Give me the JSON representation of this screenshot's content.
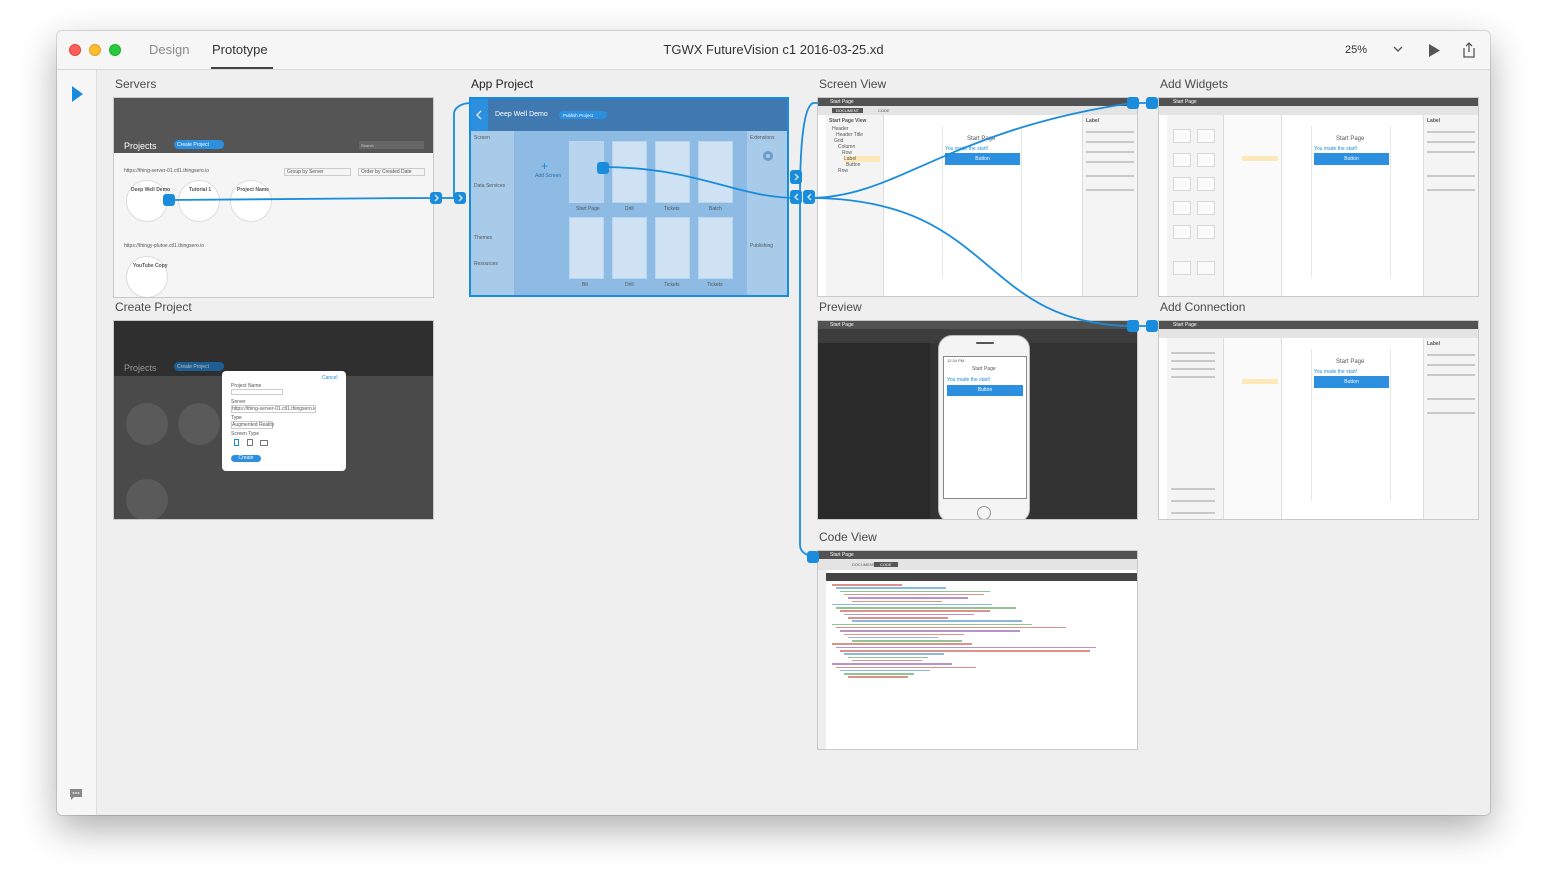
{
  "window": {
    "title": "TGWX FutureVision c1 2016-03-25.xd",
    "tabs": [
      "Design",
      "Prototype"
    ],
    "active_tab": "Prototype",
    "zoom": "25%"
  },
  "icons": {
    "play": "play-icon",
    "share": "share-icon",
    "select": "select-arrow-icon",
    "comment": "comment-icon"
  },
  "colors": {
    "accent": "#1a8cdc",
    "wire": "#1a8cdc"
  },
  "artboards": {
    "servers": {
      "label": "Servers",
      "heading": "Projects",
      "create_btn": "Create Project",
      "search": "Search",
      "group_by": "Group by Server",
      "order_by": "Order by Created Date",
      "server1": "https://thing-server-01.ctl1.thingsero.io",
      "server2": "https://thingy-plutoe.ctl1.thingsero.io",
      "projects": [
        "Deep Well Demo",
        "Tutorial 1",
        "Project Name",
        "YouTube Copy"
      ]
    },
    "create_project": {
      "label": "Create Project",
      "heading": "Projects",
      "create_btn": "Create Project",
      "cancel": "Cancel",
      "field_name": "Project Name",
      "field_server": "Server",
      "server_value": "https://thing-server-01.ctl1.thingsero.io",
      "field_type": "Type",
      "type_value": "Augmented Reality",
      "field_screen": "Screen Type",
      "create": "Create"
    },
    "app_project": {
      "label": "App Project",
      "title": "Deep Well Demo",
      "publish": "Publish Project",
      "screens": [
        "Start Page",
        "Drill",
        "Tickets",
        "Batch",
        "Bit",
        "Drill",
        "Tickets",
        "Tickets"
      ],
      "sections": [
        "Screen",
        "Data Services",
        "Themes",
        "Resources",
        "Extensions",
        "Publishing"
      ],
      "add_screen": "Add Screen"
    },
    "screen_view": {
      "label": "Screen View",
      "page": "Start Page",
      "tab_doc": "DOCUMENT",
      "tab_code": "CODE",
      "phone_title": "Start Page",
      "msg": "You made the start!",
      "button": "Button",
      "tree": [
        "Start Page View",
        "Header",
        "Header Title",
        "Grid",
        "Column",
        "Row",
        "Label",
        "Button",
        "Row"
      ],
      "panel_title": "Label"
    },
    "add_widgets": {
      "label": "Add Widgets",
      "page": "Start Page",
      "phone_title": "Start Page",
      "msg": "You made the start!",
      "button": "Button",
      "panel_title": "Label"
    },
    "preview": {
      "label": "Preview",
      "page": "Start Page",
      "phone_title": "Start Page",
      "msg": "You made the start!",
      "button": "Button",
      "time": "12:34 PM"
    },
    "add_connection": {
      "label": "Add Connection",
      "page": "Start Page",
      "phone_title": "Start Page",
      "msg": "You made the start!",
      "button": "Button",
      "panel_title": "Label"
    },
    "code_view": {
      "label": "Code View",
      "page": "Start Page",
      "tab_doc": "DOCUMENT",
      "tab_code": "CODE"
    }
  }
}
